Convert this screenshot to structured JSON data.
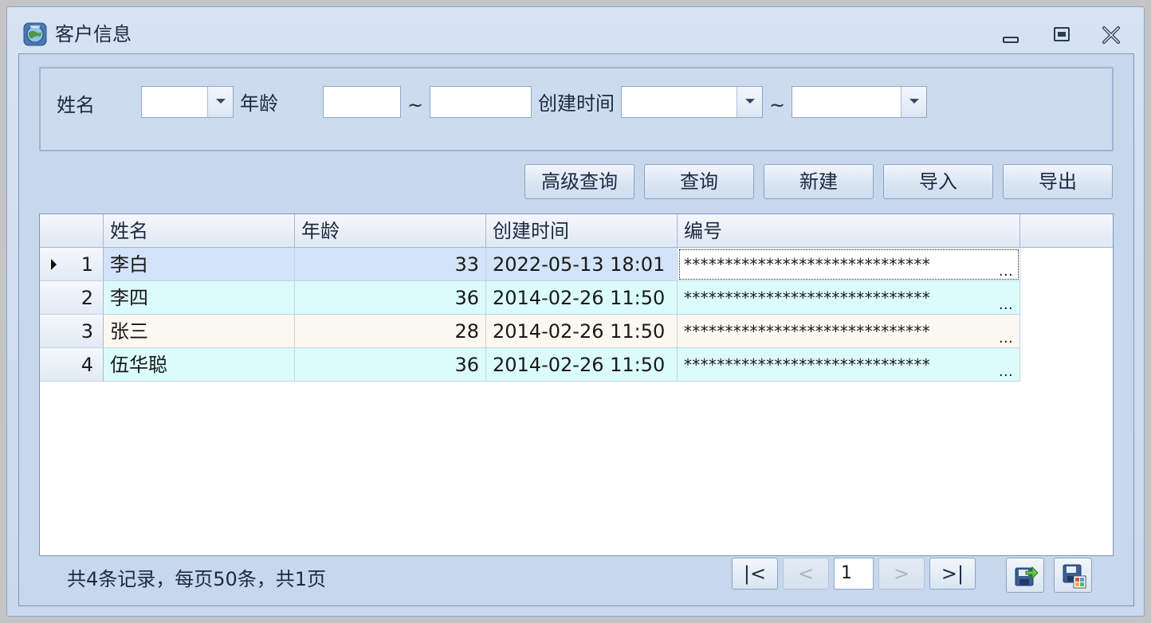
{
  "window": {
    "title": "客户信息",
    "icon": "app-globe-icon"
  },
  "filters": {
    "name_label": "姓名",
    "age_label": "年龄",
    "range_sep": "~",
    "created_label": "创建时间",
    "name_value": "",
    "age_from": "",
    "age_to": "",
    "created_from": "",
    "created_to": ""
  },
  "toolbar": {
    "advanced_search": "高级查询",
    "search": "查询",
    "create": "新建",
    "import": "导入",
    "export": "导出"
  },
  "grid": {
    "columns": [
      "姓名",
      "年龄",
      "创建时间",
      "编号"
    ],
    "rows": [
      {
        "index": "1",
        "name": "李白",
        "age": "33",
        "created": "2022-05-13 18:01",
        "code": "******************************",
        "ellipsis": "..."
      },
      {
        "index": "2",
        "name": "李四",
        "age": "36",
        "created": "2014-02-26 11:50",
        "code": "******************************",
        "ellipsis": "..."
      },
      {
        "index": "3",
        "name": "张三",
        "age": "28",
        "created": "2014-02-26 11:50",
        "code": "******************************",
        "ellipsis": "..."
      },
      {
        "index": "4",
        "name": "伍华聪",
        "age": "36",
        "created": "2014-02-26 11:50",
        "code": "******************************",
        "ellipsis": "..."
      }
    ]
  },
  "footer": {
    "summary": "共4条记录，每页50条，共1页",
    "first": "|<",
    "prev": "<",
    "page": "1",
    "next": ">",
    "last": ">|"
  },
  "colors": {
    "row_selected": "#d3e3f8",
    "row_alt": "#dcfcfc",
    "row_odd": "#faf8f0"
  }
}
